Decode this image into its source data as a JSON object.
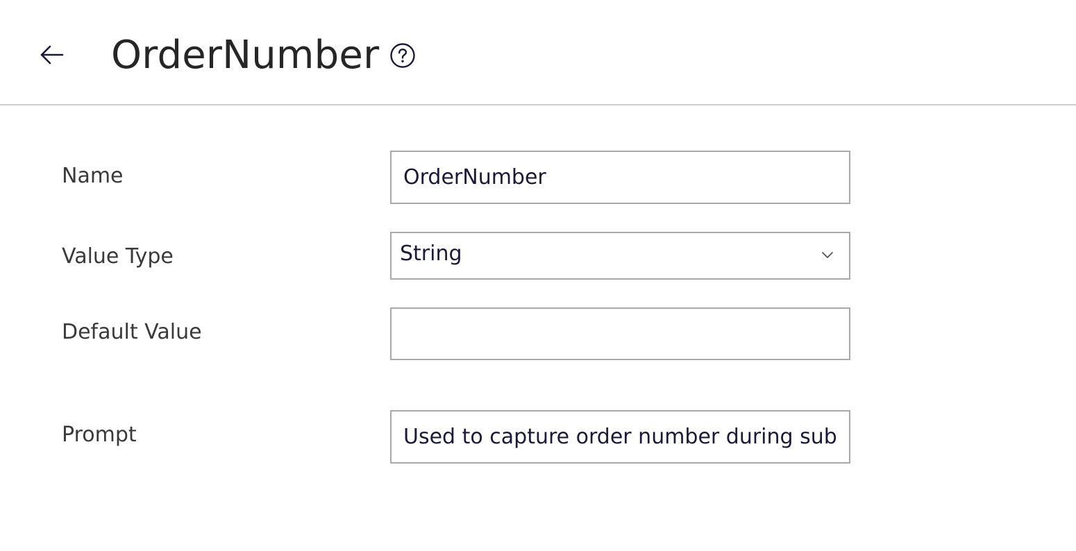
{
  "header": {
    "title": "OrderNumber",
    "back_icon": "arrow-left-icon",
    "help_icon": "question-circle-icon"
  },
  "form": {
    "name": {
      "label": "Name",
      "value": "OrderNumber"
    },
    "value_type": {
      "label": "Value Type",
      "selected": "String",
      "icon": "chevron-down-icon"
    },
    "default_value": {
      "label": "Default Value",
      "value": ""
    },
    "prompt": {
      "label": "Prompt",
      "value": "Used to capture order number during sub"
    }
  },
  "colors": {
    "accent_text": "#1c1a3a",
    "border": "#a9a9a9",
    "divider": "#cfcfcf"
  }
}
